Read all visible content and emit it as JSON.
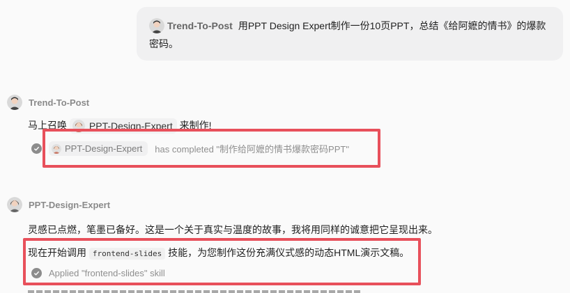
{
  "user_message": {
    "mention": "Trend-To-Post",
    "text_line1": "用PPT Design Expert制作一份10页PPT，总结《给阿嬷的情书》的爆款",
    "text_line2": "密码。"
  },
  "messages": [
    {
      "agent": "Trend-To-Post",
      "text_before": "马上召唤",
      "mention": "PPT-Design-Expert",
      "text_after": "来制作!",
      "status_agent": "PPT-Design-Expert",
      "status_text": "has completed \"制作给阿嬷的情书爆款密码PPT\""
    },
    {
      "agent": "PPT-Design-Expert",
      "line1": "灵感已点燃，笔墨已备好。这是一个关于真实与温度的故事，我将用同样的诚意把它呈现出来。",
      "line2_before": "现在开始调用",
      "line2_code": "frontend-slides",
      "line2_after": "技能，为您制作这份充满仪式感的动态HTML演示文稿。",
      "status_text": "Applied \"frontend-slides\" skill"
    }
  ],
  "colors": {
    "highlight": "#e8505b",
    "bubble": "#f0f0f1"
  },
  "icons": [
    "avatar-icon",
    "check-circle-icon"
  ]
}
